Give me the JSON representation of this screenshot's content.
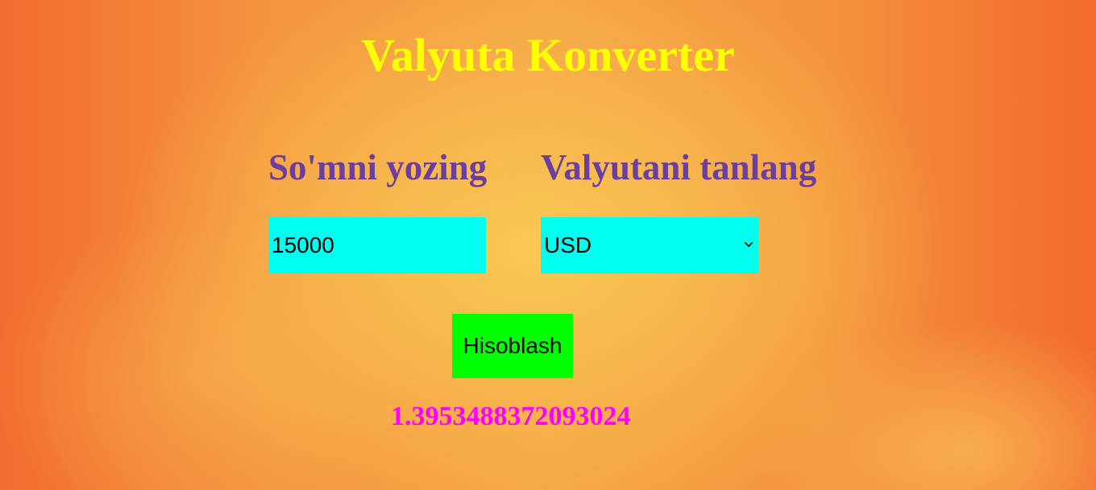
{
  "page": {
    "title": "Valyuta Konverter"
  },
  "form": {
    "amount_label": "So'mni yozing",
    "currency_label": "Valyutani tanlang",
    "amount_value": "15000",
    "currency_selected": "USD",
    "submit_label": "Hisoblash"
  },
  "result": {
    "value": "1.3953488372093024"
  },
  "colors": {
    "title": "#ffff00",
    "labels": "#6a3fa0",
    "inputs_bg": "#00ffee",
    "button_bg": "#00ff00",
    "result": "#ff00ff",
    "background_edge": "#f26c30",
    "background_center": "#f9c852"
  },
  "icons": {
    "select_arrow": "chevron-down-icon"
  }
}
